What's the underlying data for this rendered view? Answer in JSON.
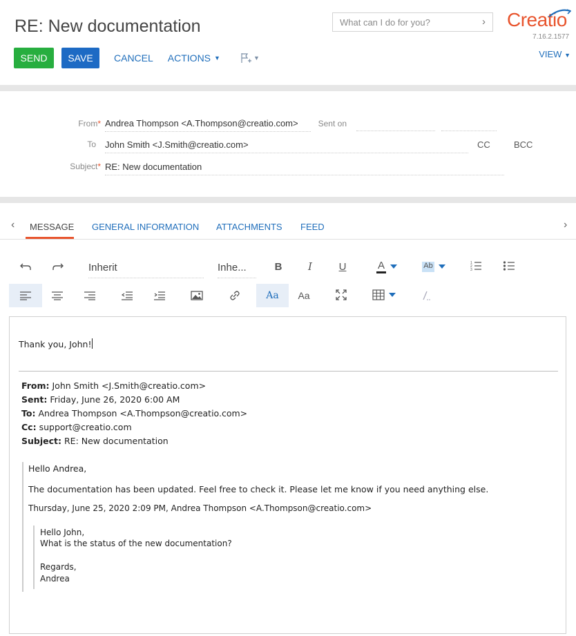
{
  "header": {
    "title": "RE: New documentation",
    "search_placeholder": "What can I do for you?",
    "logo_text": "Creatio",
    "version": "7.16.2.1577",
    "view_label": "VIEW"
  },
  "toolbar": {
    "send_label": "SEND",
    "save_label": "SAVE",
    "cancel_label": "CANCEL",
    "actions_label": "ACTIONS"
  },
  "form": {
    "from_label": "From",
    "from_value": "Andrea Thompson <A.Thompson@creatio.com>",
    "sent_on_label": "Sent on",
    "to_label": "To",
    "to_value": "John Smith <J.Smith@creatio.com>",
    "cc_label": "CC",
    "bcc_label": "BCC",
    "subject_label": "Subject",
    "subject_value": "RE: New documentation"
  },
  "tabs": [
    {
      "label": "MESSAGE",
      "active": true
    },
    {
      "label": "GENERAL INFORMATION",
      "active": false
    },
    {
      "label": "ATTACHMENTS",
      "active": false
    },
    {
      "label": "FEED",
      "active": false
    }
  ],
  "editor_toolbar": {
    "font_family": "Inherit",
    "font_size": "Inhe...",
    "bold": "B",
    "italic": "I",
    "underline": "U",
    "font_color": "A",
    "highlight": "Ab",
    "font_case_1": "Aa",
    "font_case_2": "Aa"
  },
  "message": {
    "reply": "Thank you, John!",
    "fwd_from_label": "From:",
    "fwd_from": "John Smith <J.Smith@creatio.com>",
    "fwd_sent_label": "Sent:",
    "fwd_sent": "Friday, June 26, 2020 6:00 AM",
    "fwd_to_label": "To:",
    "fwd_to": "Andrea Thompson <A.Thompson@creatio.com>",
    "fwd_cc_label": "Cc:",
    "fwd_cc": "support@creatio.com",
    "fwd_subject_label": "Subject:",
    "fwd_subject": "RE: New documentation",
    "q1_greeting": "Hello Andrea,",
    "q1_body": "The documentation has been updated. Feel free to check it. Please let me know if you need anything else.",
    "q1_attrib": "Thursday, June 25, 2020 2:09 PM, Andrea Thompson <A.Thompson@creatio.com>",
    "q2_greeting": "Hello John,",
    "q2_body": "What is the status of the new documentation?",
    "q2_regards": "Regards,",
    "q2_name": "Andrea"
  },
  "colors": {
    "accent": "#e8542d",
    "send": "#27ae3f",
    "save": "#1d6ac4",
    "link": "#1f6ebb"
  }
}
